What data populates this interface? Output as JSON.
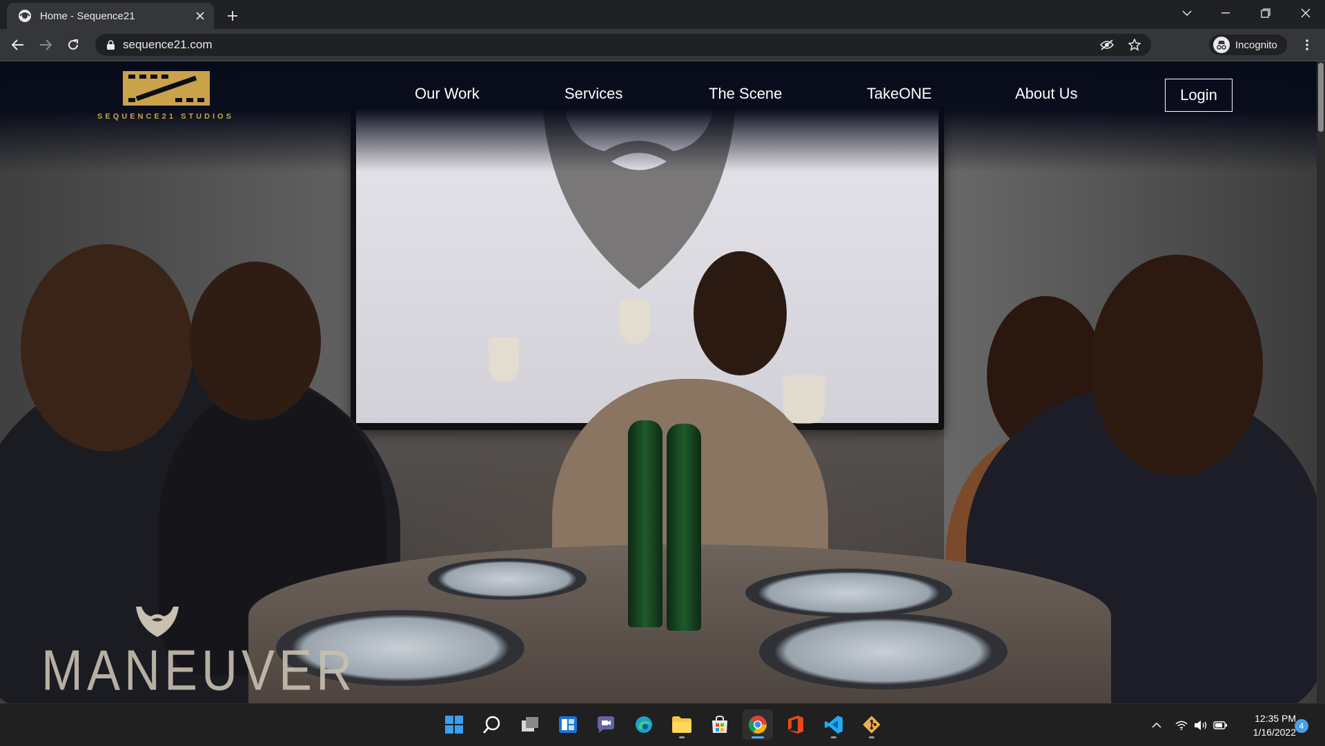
{
  "browser": {
    "tab_title": "Home - Sequence21",
    "url": "sequence21.com",
    "profile_label": "Incognito"
  },
  "site": {
    "logo_text": "SEQUENCE21 STUDIOS",
    "brand_color": "#c9a24a",
    "nav": [
      "Our Work",
      "Services",
      "The Scene",
      "TakeONE",
      "About Us"
    ],
    "login_label": "Login"
  },
  "hero": {
    "overlay_logo_text": "MANEUVER"
  },
  "taskbar": {
    "apps": [
      "windows-start-icon",
      "search-icon",
      "task-view-icon",
      "widgets-icon",
      "teams-chat-icon",
      "edge-icon",
      "file-explorer-icon",
      "microsoft-store-icon",
      "chrome-icon",
      "office-icon",
      "vscode-icon",
      "git-icon"
    ],
    "time": "12:35 PM",
    "date": "1/16/2022",
    "notification_count": "4"
  }
}
